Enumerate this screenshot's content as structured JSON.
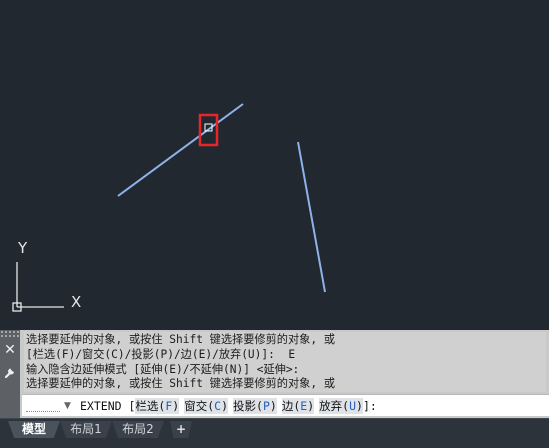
{
  "canvas": {
    "background": "#212830",
    "line_color": "#8fb2e8",
    "highlight_color": "#e8262a",
    "ucs_y_label": "Y",
    "ucs_x_label": "X"
  },
  "command_line": {
    "history": [
      "选择要延伸的对象, 或按住 Shift 键选择要修剪的对象, 或",
      "[栏选(F)/窗交(C)/投影(P)/边(E)/放弃(U)]:  E",
      "输入隐含边延伸模式 [延伸(E)/不延伸(N)] <延伸>:",
      "选择要延伸的对象, 或按住 Shift 键选择要修剪的对象, 或"
    ],
    "prompt": {
      "command": "EXTEND [",
      "options": [
        {
          "label": "栏选(",
          "key": "F",
          "end": ")"
        },
        {
          "label": "窗交(",
          "key": "C",
          "end": ")"
        },
        {
          "label": "投影(",
          "key": "P",
          "end": ")"
        },
        {
          "label": "边(",
          "key": "E",
          "end": ")"
        },
        {
          "label": "放弃(",
          "key": "U",
          "end": ")"
        }
      ],
      "suffix": "]:"
    },
    "close_icon": "close-icon",
    "settings_icon": "wrench-icon"
  },
  "tabs": {
    "model": "模型",
    "layout1": "布局1",
    "layout2": "布局2",
    "add": "+"
  }
}
